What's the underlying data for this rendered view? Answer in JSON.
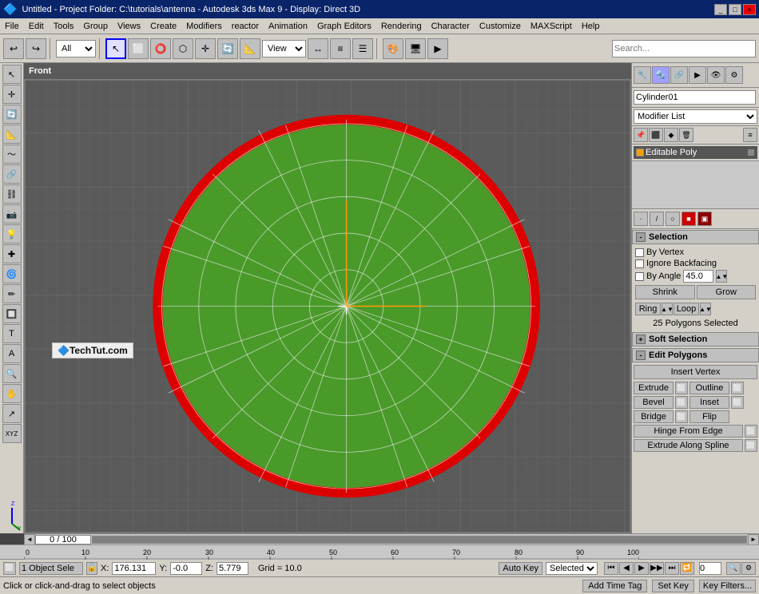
{
  "titlebar": {
    "title": "Untitled - Project Folder: C:\\tutorials\\antenna - Autodesk 3ds Max 9 - Display: Direct 3D",
    "app_name": "Untitled",
    "project": "Project Folder: C:\\tutorials\\antenna",
    "app": "Autodesk 3ds Max 9",
    "display": "Display: Direct 3D",
    "win_minimize": "_",
    "win_maximize": "□",
    "win_close": "×"
  },
  "menubar": {
    "items": [
      "File",
      "Edit",
      "Tools",
      "Group",
      "Views",
      "Create",
      "Modifiers",
      "reactor",
      "Animation",
      "Graph Editors",
      "Rendering",
      "Character",
      "Customize",
      "MAXScript",
      "Help"
    ]
  },
  "toolbar": {
    "select_type": "All",
    "view_label": "View"
  },
  "viewport": {
    "label": "Front"
  },
  "right_panel": {
    "object_name": "Cylinder01",
    "modifier_list_label": "Modifier List",
    "modifier_item": "Editable Poly",
    "icons": [
      "🔧",
      "📐",
      "📏",
      "⚙",
      "🔲",
      "📦"
    ],
    "selection_label": "Selection",
    "by_vertex_label": "By Vertex",
    "ignore_backfacing_label": "Ignore Backfacing",
    "by_angle_label": "By Angle",
    "by_angle_value": "45.0",
    "shrink_label": "Shrink",
    "grow_label": "Grow",
    "ring_label": "Ring",
    "loop_label": "Loop",
    "polygons_selected": "25 Polygons Selected",
    "soft_selection_label": "Soft Selection",
    "edit_polygons_label": "Edit Polygons",
    "insert_vertex_label": "Insert Vertex",
    "extrude_label": "Extrude",
    "outline_label": "Outline",
    "bevel_label": "Bevel",
    "inset_label": "Inset",
    "bridge_label": "Bridge",
    "flip_label": "Flip",
    "hinge_from_edge_label": "Hinge From Edge",
    "extrude_along_spline_label": "Extrude Along Spline"
  },
  "statusbar": {
    "object_count": "1 Object Sele",
    "x_label": "X:",
    "x_value": "176.131",
    "y_label": "Y:",
    "y_value": "-0.0",
    "z_label": "Z:",
    "z_value": "5.779",
    "grid_label": "Grid = 10.0",
    "auto_key_label": "Auto Key",
    "selected_label": "Selected"
  },
  "statusbar2": {
    "message": "Click or click-and-drag to select objects",
    "add_time_tag_label": "Add Time Tag",
    "set_key_label": "Set Key",
    "key_filters_label": "Key Filters...",
    "frame_value": "0"
  },
  "timeline": {
    "frame_range": "0 / 100"
  },
  "ruler": {
    "marks": [
      "0",
      "10",
      "20",
      "30",
      "40",
      "50",
      "60",
      "70",
      "80",
      "90",
      "100"
    ]
  },
  "watermark": {
    "text": "TechTut.com"
  }
}
